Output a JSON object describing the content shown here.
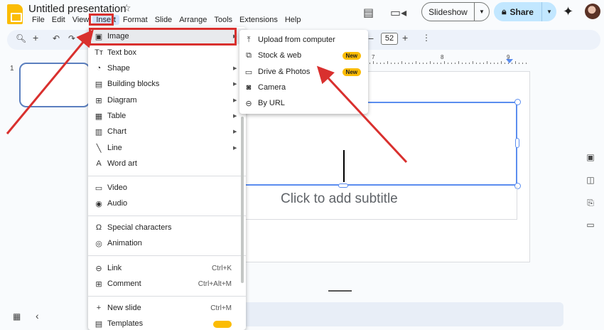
{
  "header": {
    "title": "Untitled presentation",
    "menus": [
      "File",
      "Edit",
      "View",
      "Insert",
      "Format",
      "Slide",
      "Arrange",
      "Tools",
      "Extensions",
      "Help"
    ],
    "active_menu": "Insert",
    "slideshow_label": "Slideshow",
    "share_label": "Share"
  },
  "toolbar": {
    "zoom_value": "52",
    "minus": "−",
    "plus": "+"
  },
  "ruler": {
    "numbers": [
      "7",
      "8",
      "9"
    ]
  },
  "filmstrip": {
    "slide_number": "1"
  },
  "canvas": {
    "subtitle_placeholder": "Click to add subtitle"
  },
  "insert_menu": {
    "items": [
      {
        "label": "Image",
        "icon": "image-icon",
        "submenu": true
      },
      {
        "label": "Text box",
        "icon": "text-box-icon",
        "submenu": false
      },
      {
        "label": "Shape",
        "icon": "shape-icon",
        "submenu": true
      },
      {
        "label": "Building blocks",
        "icon": "building-blocks-icon",
        "submenu": true
      },
      {
        "label": "Diagram",
        "icon": "diagram-icon",
        "submenu": true
      },
      {
        "label": "Table",
        "icon": "table-icon",
        "submenu": true
      },
      {
        "label": "Chart",
        "icon": "chart-icon",
        "submenu": true
      },
      {
        "label": "Line",
        "icon": "line-icon",
        "submenu": true
      },
      {
        "label": "Word art",
        "icon": "word-art-icon",
        "submenu": false
      },
      {
        "label": "Video",
        "icon": "video-icon",
        "submenu": false
      },
      {
        "label": "Audio",
        "icon": "audio-icon",
        "submenu": false
      },
      {
        "label": "Special characters",
        "icon": "omega-icon",
        "submenu": false
      },
      {
        "label": "Animation",
        "icon": "animation-icon",
        "submenu": false
      },
      {
        "label": "Link",
        "icon": "link-icon",
        "shortcut": "Ctrl+K"
      },
      {
        "label": "Comment",
        "icon": "comment-icon",
        "shortcut": "Ctrl+Alt+M"
      },
      {
        "label": "New slide",
        "icon": "plus-icon",
        "shortcut": "Ctrl+M"
      },
      {
        "label": "Templates",
        "icon": "templates-icon",
        "submenu": false
      }
    ]
  },
  "image_submenu": {
    "items": [
      {
        "label": "Upload from computer",
        "icon": "upload-icon",
        "badge": ""
      },
      {
        "label": "Stock & web",
        "icon": "stock-web-icon",
        "badge": "New"
      },
      {
        "label": "Drive & Photos",
        "icon": "folder-icon",
        "badge": "New"
      },
      {
        "label": "Camera",
        "icon": "camera-icon",
        "badge": ""
      },
      {
        "label": "By URL",
        "icon": "link-icon",
        "badge": ""
      }
    ]
  },
  "colors": {
    "accent": "#5b8def",
    "annotation_red": "#d9302e",
    "badge_yellow": "#fbbc04",
    "share_bg": "#c2e7ff"
  }
}
